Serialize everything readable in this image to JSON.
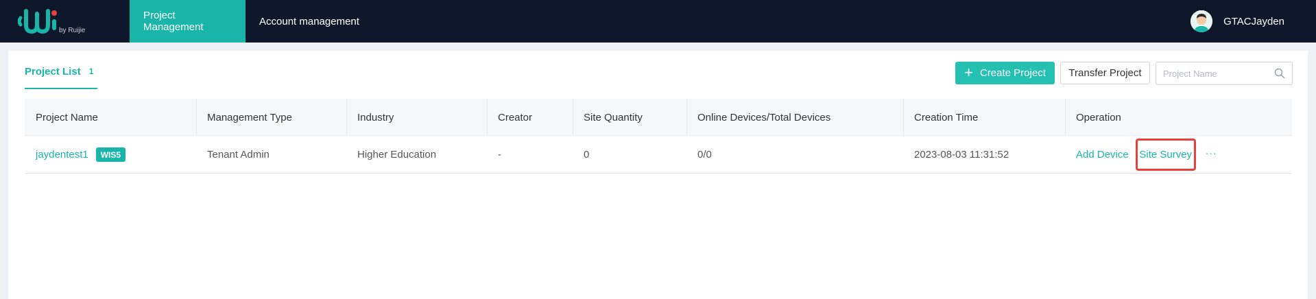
{
  "header": {
    "logo_text": "by Ruijie",
    "nav": [
      {
        "label": "Project Management",
        "active": true
      },
      {
        "label": "Account management",
        "active": false
      }
    ],
    "user_name": "GTACJayden"
  },
  "toolbar": {
    "tab_label": "Project List",
    "tab_count": "1",
    "create_label": "Create Project",
    "transfer_label": "Transfer Project",
    "search_placeholder": "Project Name"
  },
  "table": {
    "columns": [
      "Project Name",
      "Management Type",
      "Industry",
      "Creator",
      "Site Quantity",
      "Online Devices/Total Devices",
      "Creation Time",
      "Operation"
    ],
    "rows": [
      {
        "project_name": "jaydentest1",
        "badge": "WIS5",
        "management_type": "Tenant Admin",
        "industry": "Higher Education",
        "creator": "-",
        "site_quantity": "0",
        "devices": "0/0",
        "creation_time": "2023-08-03 11:31:52",
        "op_add_device": "Add Device",
        "op_site_survey": "Site Survey",
        "op_more": "···"
      }
    ]
  },
  "colors": {
    "accent": "#1ab5a9",
    "topbar": "#0f182b",
    "highlight": "#e8413a"
  }
}
